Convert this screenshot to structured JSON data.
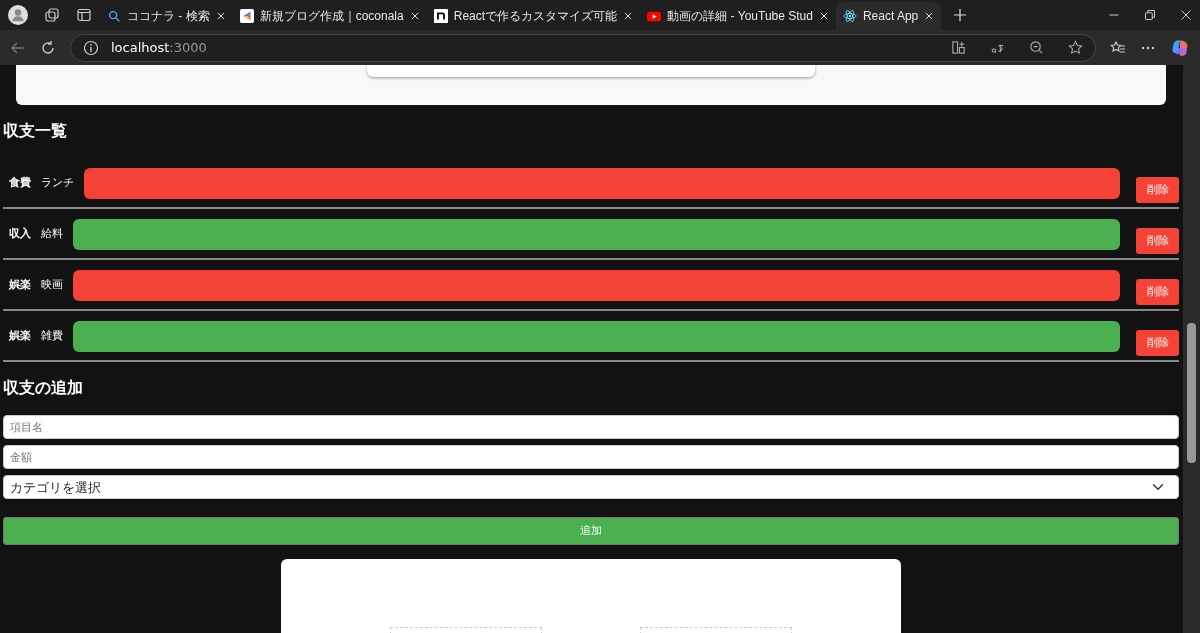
{
  "browser": {
    "tabs": [
      {
        "title": "ココナラ - 検索",
        "selected": false
      },
      {
        "title": "新規ブログ作成｜coconala",
        "selected": false
      },
      {
        "title": "Reactで作るカスタマイズ可能",
        "selected": false
      },
      {
        "title": "動画の詳細 - YouTube Stud",
        "selected": false
      },
      {
        "title": "React App",
        "selected": true
      }
    ],
    "address": {
      "host": "localhost",
      "port": ":3000"
    }
  },
  "list": {
    "heading": "収支一覧",
    "entries": [
      {
        "category": "食費",
        "name": "ランチ",
        "kind": "expense",
        "delete_label": "削除"
      },
      {
        "category": "収入",
        "name": "給料",
        "kind": "income",
        "delete_label": "削除"
      },
      {
        "category": "娯楽",
        "name": "映画",
        "kind": "expense",
        "delete_label": "削除"
      },
      {
        "category": "娯楽",
        "name": "雑費",
        "kind": "income",
        "delete_label": "削除"
      }
    ]
  },
  "form": {
    "heading": "収支の追加",
    "name_field": {
      "placeholder": "項目名"
    },
    "amount_field": {
      "placeholder": "金額"
    },
    "category_select": {
      "value": "カテゴリを選択"
    },
    "submit": "追加"
  }
}
